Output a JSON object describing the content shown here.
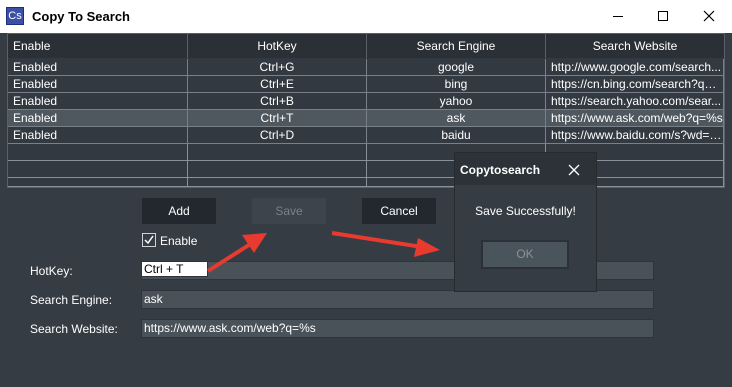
{
  "window": {
    "app_icon_text": "Cs",
    "title": "Copy To Search",
    "controls": {
      "minimize_icon": "minimize-icon",
      "maximize_icon": "maximize-icon",
      "close_icon": "close-icon"
    }
  },
  "table": {
    "headers": [
      "Enable",
      "HotKey",
      "Search Engine",
      "Search Website"
    ],
    "rows": [
      [
        "Enabled",
        "Ctrl+G",
        "google",
        "http://www.google.com/search..."
      ],
      [
        "Enabled",
        "Ctrl+E",
        "bing",
        "https://cn.bing.com/search?q=%s"
      ],
      [
        "Enabled",
        "Ctrl+B",
        "yahoo",
        "https://search.yahoo.com/sear..."
      ],
      [
        "Enabled",
        "Ctrl+T",
        "ask",
        "https://www.ask.com/web?q=%s"
      ],
      [
        "Enabled",
        "Ctrl+D",
        "baidu",
        "https://www.baidu.com/s?wd=%s"
      ]
    ],
    "selected_row": 3
  },
  "form": {
    "add_label": "Add",
    "save_label": "Save",
    "cancel_label": "Cancel",
    "enable_label": "Enable",
    "enable_checked": true,
    "hotkey_label": "HotKey:",
    "hotkey_value": "Ctrl + T",
    "engine_label": "Search Engine:",
    "engine_value": "ask",
    "website_label": "Search Website:",
    "website_value": "https://www.ask.com/web?q=%s"
  },
  "dialog": {
    "title": "Copytosearch",
    "message": "Save Successfully!",
    "ok_label": "OK"
  },
  "colors": {
    "background": "#353c43",
    "arrow": "#e83a2f",
    "selected_row": "#50585f"
  }
}
